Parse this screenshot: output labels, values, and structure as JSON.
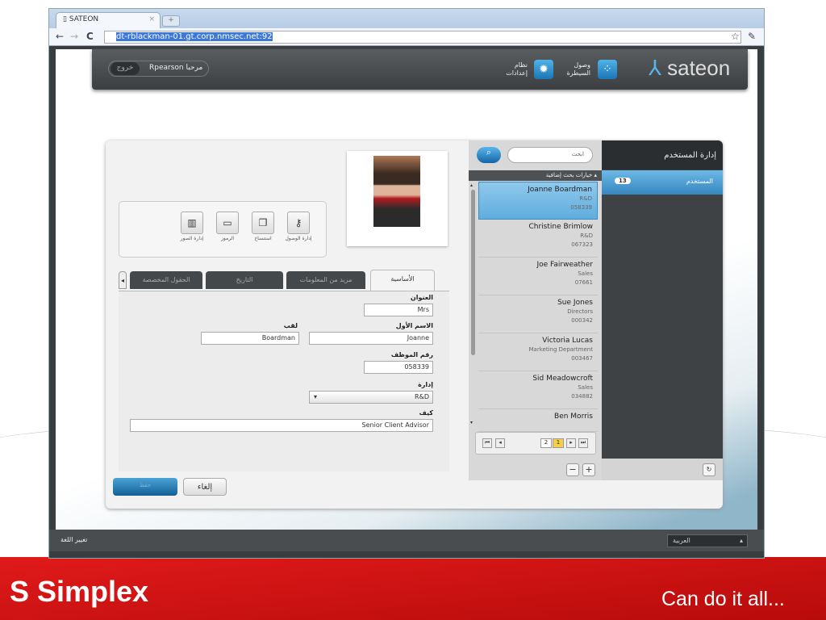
{
  "browser": {
    "tab_title": "SATEON",
    "url": "dt-rblackman-01.gt.corp.nmsec.net:92"
  },
  "header": {
    "logout": "خروج",
    "greeting": "Rpearson مرحبا",
    "system_settings": [
      "نظام",
      "إعدادات"
    ],
    "access_control": [
      "وصول",
      "السيطرة"
    ],
    "logo": "sateon"
  },
  "photo_tools": [
    {
      "label": "إدارة الوصول",
      "icon": "key-icon"
    },
    {
      "label": "استنساخ",
      "icon": "copy-icon"
    },
    {
      "label": "الرموز",
      "icon": "card-icon"
    },
    {
      "label": "إدارة الصور",
      "icon": "film-icon"
    }
  ],
  "tabs": [
    "الأساسية",
    "مزيد من المعلومات",
    "التاريخ",
    "الحقول المخصصة"
  ],
  "form": {
    "title_label": "العنوان",
    "title_value": "Mrs",
    "first_label": "الاسم الأول",
    "first_value": "Joanne",
    "last_label": "لقب",
    "last_value": "Boardman",
    "emp_label": "رقم الموظف",
    "emp_value": "058339",
    "dept_label": "إدارة",
    "dept_value": "R&D",
    "job_label": "كيف",
    "job_value": "Senior Client Advisor"
  },
  "buttons": {
    "cancel": "إلغاء",
    "save": "حفظ"
  },
  "list": {
    "search_placeholder": "ابحث",
    "advanced": "خيارات بحث إضافية",
    "items": [
      {
        "name": "Joanne Boardman",
        "dept": "R&D",
        "id": "058339"
      },
      {
        "name": "Christine Brimlow",
        "dept": "R&D",
        "id": "067323"
      },
      {
        "name": "Joe Fairweather",
        "dept": "Sales",
        "id": "07661"
      },
      {
        "name": "Sue Jones",
        "dept": "Directors",
        "id": "000342"
      },
      {
        "name": "Victoria Lucas",
        "dept": "Marketing Department",
        "id": "003467"
      },
      {
        "name": "Sid Meadowcroft",
        "dept": "Sales",
        "id": "034882"
      },
      {
        "name": "Ben Morris",
        "dept": "",
        "id": ""
      }
    ],
    "pages": [
      "2",
      "1"
    ]
  },
  "right_panel": {
    "title": "إدارة المستخدم",
    "item": "المستخدم",
    "count": "13"
  },
  "footer": {
    "change_language": "تغيير اللغة",
    "language": "العربية"
  },
  "slide": {
    "brand": "Simplex",
    "tagline": "Can do it all..."
  }
}
